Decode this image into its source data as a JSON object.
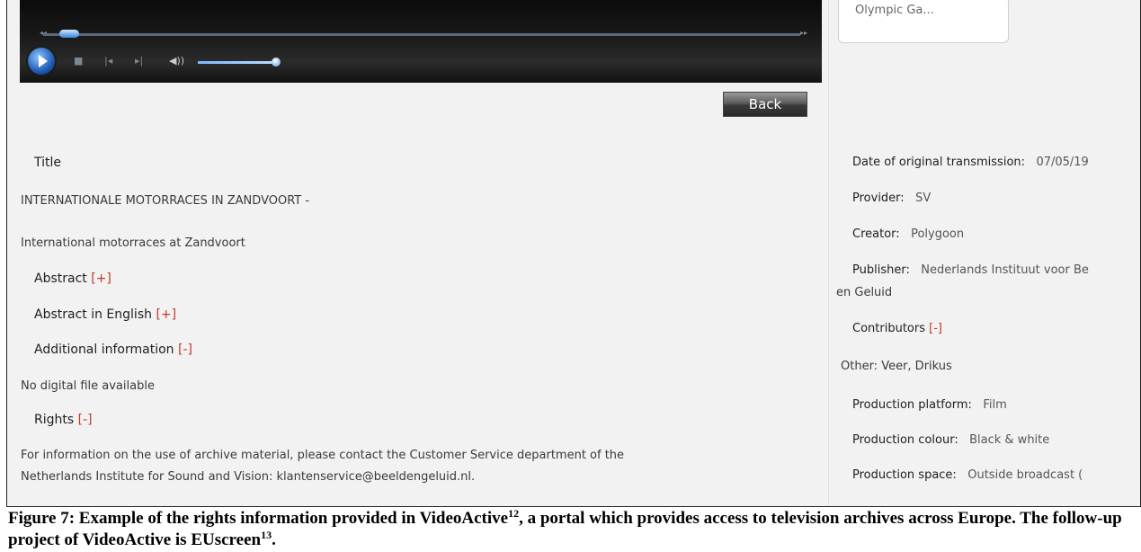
{
  "player": {
    "seek_rewind": "◂◂",
    "seek_forward": "▸▸",
    "stop_symbol": "■",
    "prev_symbol": "|◂",
    "next_symbol": "▸|",
    "volume_symbol": "◀))"
  },
  "back_label": "Back",
  "search_card_text": "Olympic Ga...",
  "left": {
    "title_heading": "Title",
    "title_value": "INTERNATIONALE MOTORRACES IN ZANDVOORT -",
    "english_title": "International motorraces at Zandvoort",
    "abstract_label": "Abstract",
    "abstract_toggle": "[+]",
    "abstract_en_label": "Abstract in English",
    "abstract_en_toggle": "[+]",
    "additional_label": "Additional information",
    "additional_toggle": "[-]",
    "digital_file": "No digital file available",
    "rights_label": "Rights",
    "rights_toggle": "[-]",
    "rights_line1": "For information on the use of archive material, please contact the Customer Service department of the",
    "rights_line2": "Netherlands Institute for Sound and Vision: klantenservice@beeldengeluid.nl."
  },
  "right": {
    "date_label": "Date of original transmission:",
    "date_value": "07/05/19",
    "provider_label": "Provider:",
    "provider_value": "SV",
    "creator_label": "Creator:",
    "creator_value": "Polygoon",
    "publisher_label": "Publisher:",
    "publisher_value": "Nederlands Instituut voor Be",
    "publisher_value2": "en Geluid",
    "contributors_label": "Contributors",
    "contributors_toggle": "[-]",
    "other": "Other: Veer, Drikus",
    "platform_label": "Production platform:",
    "platform_value": "Film",
    "colour_label": "Production colour:",
    "colour_value": "Black & white",
    "space_label": "Production space:",
    "space_value": "Outside broadcast ("
  },
  "caption": {
    "part1": "Figure 7: Example of the rights information provided in VideoActive",
    "sup1": "12",
    "part2": ", a portal which provides access to television archives across Europe. The follow-up project of VideoActive is EUscreen",
    "sup2": "13",
    "part3": "."
  },
  "colors": {
    "toggle_red": "#c0392b",
    "player_blue": "#1f5cb4",
    "background": "#f2f2f2"
  }
}
